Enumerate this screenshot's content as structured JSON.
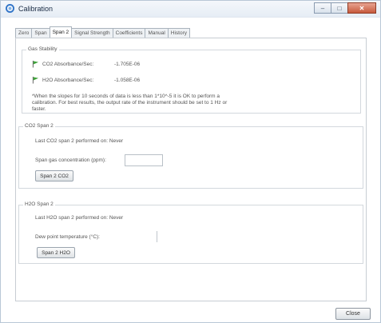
{
  "window": {
    "title": "Calibration",
    "controls": {
      "minimize": "–",
      "maximize": "□",
      "close": "✕"
    }
  },
  "tabs": [
    "Zero",
    "Span",
    "Span 2",
    "Signal Strength",
    "Coefficients",
    "Manual",
    "History"
  ],
  "active_tab": "Span 2",
  "gas_stability": {
    "title": "Gas Stability",
    "rows": [
      {
        "label": "CO2 Absorbance/Sec:",
        "value": "-1.705E-06",
        "icon": "green-flag-icon"
      },
      {
        "label": "H2O Absorbance/Sec:",
        "value": "-1.058E-06",
        "icon": "green-flag-icon"
      }
    ],
    "note": "*When the slopes for 10 seconds of data is less than 1*10^-5 it is OK to perform a calibration. For best results, the output rate of the instrument should be set to 1 Hz or faster."
  },
  "co2_span2": {
    "title": "CO2 Span 2",
    "last_performed": "Last CO2 span 2 performed on:  Never",
    "concentration_label": "Span gas concentration (ppm):",
    "concentration_value": "",
    "button": "Span 2 CO2"
  },
  "h2o_span2": {
    "title": "H2O Span 2",
    "last_performed": "Last H2O span 2 performed on:  Never",
    "dewpoint_label": "Dew point temperature (°C):",
    "dewpoint_value": "",
    "button": "Span 2 H2O"
  },
  "footer": {
    "close_button": "Close"
  },
  "colors": {
    "flag": "#3fa33a",
    "accent": "#2f73c7"
  }
}
